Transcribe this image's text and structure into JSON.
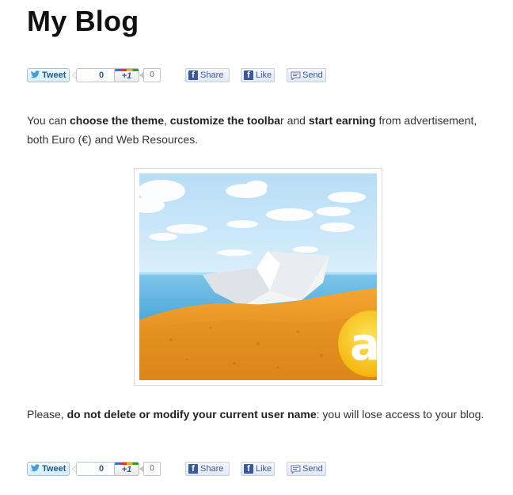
{
  "blog": {
    "title": "My Blog"
  },
  "share_top": {
    "tweet_label": "Tweet",
    "tweet_count": "0",
    "plusone_label": "+1",
    "plusone_count": "0",
    "share_label": "Share",
    "like_label": "Like",
    "send_label": "Send"
  },
  "post": {
    "p1": {
      "t1": "You can ",
      "b1": "choose the theme",
      "t2": ", ",
      "b2": "customize the toolba",
      "t3": "r and ",
      "b3": "start earning",
      "t4": " from advertisement, both Euro (€) and Web Resources."
    },
    "image": {
      "description_icon": "sailboat-photo"
    },
    "p2": {
      "t1": "Please, ",
      "b1": "do not delete or modify your current user name",
      "t2": ": you will lose access to your blog."
    }
  },
  "share_bottom": {
    "tweet_label": "Tweet",
    "tweet_count": "0",
    "plusone_label": "+1",
    "plusone_count": "0",
    "share_label": "Share",
    "like_label": "Like",
    "send_label": "Send"
  },
  "colors": {
    "twitter": "#1d5a8a",
    "facebook": "#3b5998",
    "text": "#333333",
    "title": "#111111"
  }
}
